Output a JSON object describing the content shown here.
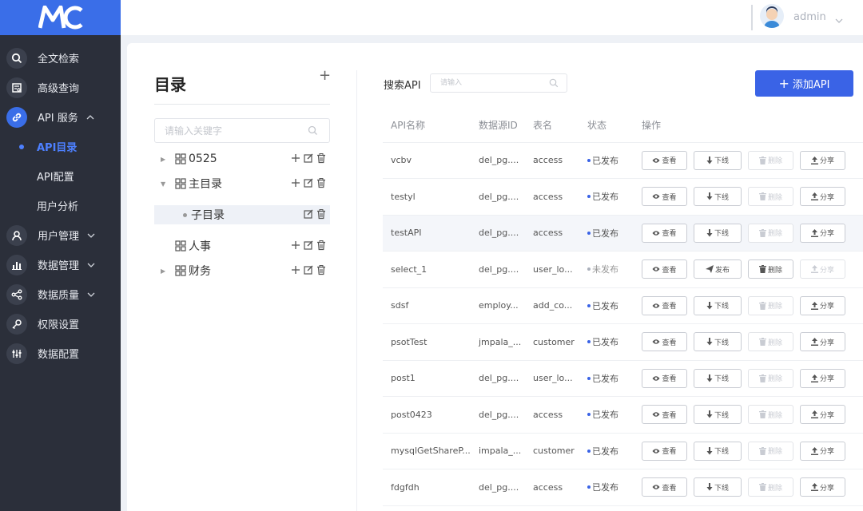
{
  "sidebar": {
    "logo": "MC",
    "items": [
      {
        "label": "全文检索",
        "icon": "search-icon"
      },
      {
        "label": "高级查询",
        "icon": "query-icon"
      },
      {
        "label": "API 服务",
        "icon": "link-icon"
      },
      {
        "label": "用户管理",
        "icon": "user-icon"
      },
      {
        "label": "数据管理",
        "icon": "bar-chart-icon"
      },
      {
        "label": "数据质量",
        "icon": "share-nodes-icon"
      },
      {
        "label": "权限设置",
        "icon": "key-icon"
      },
      {
        "label": "数据配置",
        "icon": "sliders-icon"
      }
    ],
    "api_sub": [
      "API目录",
      "API配置",
      "用户分析"
    ]
  },
  "header": {
    "username": "admin"
  },
  "directory": {
    "title": "目录",
    "add": "+",
    "search_placeholder": "请输入关键字",
    "nodes": [
      "0525",
      "主目录",
      "子目录",
      "人事",
      "财务"
    ]
  },
  "api": {
    "search_label": "搜索API",
    "search_placeholder": "请输入",
    "add_label": "添加API",
    "columns": [
      "API名称",
      "数据源ID",
      "表名",
      "状态",
      "操作"
    ],
    "ops": {
      "view": "查看",
      "offline": "下线",
      "publish": "发布",
      "delete": "删除",
      "share": "分享"
    },
    "rows": [
      {
        "name": "vcbv",
        "source": "del_pg....",
        "table": "access",
        "status": "已发布",
        "published": true
      },
      {
        "name": "testyl",
        "source": "del_pg....",
        "table": "access",
        "status": "已发布",
        "published": true
      },
      {
        "name": "testAPI",
        "source": "del_pg....",
        "table": "access",
        "status": "已发布",
        "published": true
      },
      {
        "name": "select_1",
        "source": "del_pg....",
        "table": "user_lo...",
        "status": "未发布",
        "published": false
      },
      {
        "name": "sdsf",
        "source": "employ...",
        "table": "add_co...",
        "status": "已发布",
        "published": true
      },
      {
        "name": "psotTest",
        "source": "jmpala_...",
        "table": "customer",
        "status": "已发布",
        "published": true
      },
      {
        "name": "post1",
        "source": "del_pg....",
        "table": "user_lo...",
        "status": "已发布",
        "published": true
      },
      {
        "name": "post0423",
        "source": "del_pg....",
        "table": "access",
        "status": "已发布",
        "published": true
      },
      {
        "name": "mysqlGetShareP...",
        "source": "impala_...",
        "table": "customer",
        "status": "已发布",
        "published": true
      },
      {
        "name": "fdgfdh",
        "source": "del_pg....",
        "table": "access",
        "status": "已发布",
        "published": true
      }
    ]
  },
  "colors": {
    "accent": "#3a63e6",
    "published": "#3a63e6",
    "unpublished": "#aab0bb"
  }
}
